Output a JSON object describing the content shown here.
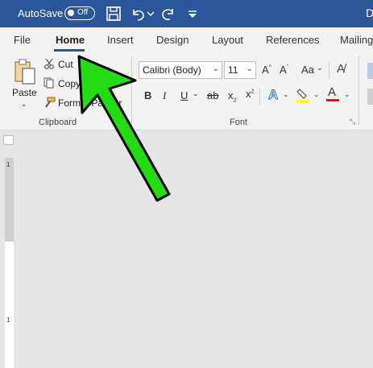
{
  "titlebar": {
    "autosave_label": "AutoSave",
    "toggle_state": "Off",
    "title_clip": "D"
  },
  "tabs": [
    {
      "label": "File"
    },
    {
      "label": "Home"
    },
    {
      "label": "Insert"
    },
    {
      "label": "Design"
    },
    {
      "label": "Layout"
    },
    {
      "label": "References"
    },
    {
      "label": "Mailing"
    }
  ],
  "clipboard": {
    "paste_label": "Paste",
    "cut_label": "Cut",
    "copy_label": "Copy",
    "format_painter_label": "Format Painter",
    "group_label": "Clipboard"
  },
  "font": {
    "font_name": "Calibri (Body)",
    "font_size": "11",
    "change_case_label": "Aa",
    "bold": "B",
    "italic": "I",
    "underline": "U",
    "strikethrough": "ab",
    "subscript": "x",
    "superscript": "x",
    "group_label": "Font"
  },
  "colors": {
    "titlebar": "#2b579a",
    "annotation_arrow": "#22dd11",
    "highlight_yellow": "#ffff00",
    "font_color_red": "#e81123"
  }
}
